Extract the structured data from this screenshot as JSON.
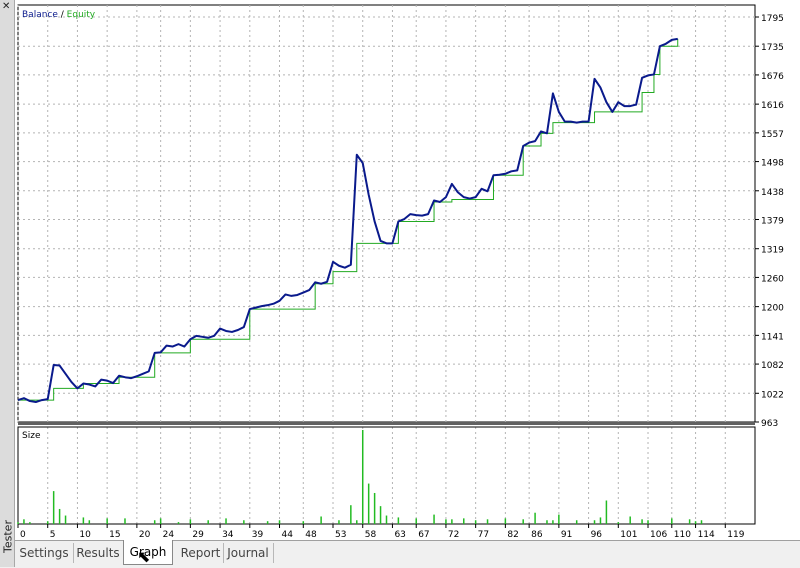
{
  "window": {
    "side_label": "Tester",
    "close_glyph": "✕"
  },
  "tabs": [
    "Settings",
    "Results",
    "Graph",
    "Report",
    "Journal"
  ],
  "active_tab": "Graph",
  "colors": {
    "balance": "#0a1a8c",
    "equity": "#22aa22",
    "size_bars": "#22bb22",
    "grid": "#b4b4b4",
    "frame": "#000000"
  },
  "chart_data": [
    {
      "type": "line",
      "legend": [
        {
          "name": "Balance",
          "color": "#0a1a8c"
        },
        {
          "name": "Equity",
          "color": "#22aa22"
        }
      ],
      "ylim": [
        963,
        1795
      ],
      "y_ticks": [
        1795,
        1735,
        1676,
        1616,
        1557,
        1498,
        1438,
        1379,
        1319,
        1260,
        1200,
        1141,
        1082,
        1022,
        963
      ],
      "x_ticks": [
        0,
        5,
        10,
        15,
        20,
        24,
        29,
        34,
        39,
        44,
        48,
        53,
        58,
        63,
        67,
        72,
        77,
        82,
        86,
        91,
        96,
        101,
        106,
        110,
        114,
        119
      ],
      "xlim": [
        0,
        124
      ],
      "series": [
        {
          "name": "Balance",
          "points": [
            [
              0,
              1008
            ],
            [
              1,
              1012
            ],
            [
              2,
              1006
            ],
            [
              3,
              1004
            ],
            [
              4,
              1008
            ],
            [
              5,
              1010
            ],
            [
              6,
              1080
            ],
            [
              7,
              1079
            ],
            [
              8,
              1062
            ],
            [
              9,
              1045
            ],
            [
              10,
              1032
            ],
            [
              11,
              1042
            ],
            [
              12,
              1040
            ],
            [
              13,
              1036
            ],
            [
              14,
              1050
            ],
            [
              15,
              1048
            ],
            [
              16,
              1043
            ],
            [
              17,
              1058
            ],
            [
              18,
              1055
            ],
            [
              19,
              1053
            ],
            [
              20,
              1057
            ],
            [
              21,
              1062
            ],
            [
              22,
              1067
            ],
            [
              23,
              1105
            ],
            [
              24,
              1106
            ],
            [
              25,
              1120
            ],
            [
              26,
              1118
            ],
            [
              27,
              1123
            ],
            [
              28,
              1118
            ],
            [
              29,
              1133
            ],
            [
              30,
              1140
            ],
            [
              31,
              1138
            ],
            [
              32,
              1136
            ],
            [
              33,
              1140
            ],
            [
              34,
              1155
            ],
            [
              35,
              1150
            ],
            [
              36,
              1148
            ],
            [
              37,
              1152
            ],
            [
              38,
              1158
            ],
            [
              39,
              1195
            ],
            [
              40,
              1198
            ],
            [
              41,
              1201
            ],
            [
              42,
              1203
            ],
            [
              43,
              1206
            ],
            [
              44,
              1212
            ],
            [
              45,
              1225
            ],
            [
              46,
              1222
            ],
            [
              47,
              1224
            ],
            [
              48,
              1229
            ],
            [
              49,
              1234
            ],
            [
              50,
              1250
            ],
            [
              51,
              1247
            ],
            [
              52,
              1251
            ],
            [
              53,
              1292
            ],
            [
              54,
              1284
            ],
            [
              55,
              1280
            ],
            [
              56,
              1286
            ],
            [
              57,
              1512
            ],
            [
              58,
              1495
            ],
            [
              59,
              1430
            ],
            [
              60,
              1375
            ],
            [
              61,
              1335
            ],
            [
              62,
              1330
            ],
            [
              63,
              1330
            ],
            [
              64,
              1375
            ],
            [
              65,
              1380
            ],
            [
              66,
              1390
            ],
            [
              67,
              1388
            ],
            [
              68,
              1387
            ],
            [
              69,
              1390
            ],
            [
              70,
              1418
            ],
            [
              71,
              1415
            ],
            [
              72,
              1425
            ],
            [
              73,
              1452
            ],
            [
              74,
              1435
            ],
            [
              75,
              1425
            ],
            [
              76,
              1422
            ],
            [
              77,
              1425
            ],
            [
              78,
              1442
            ],
            [
              79,
              1437
            ],
            [
              80,
              1470
            ],
            [
              81,
              1471
            ],
            [
              82,
              1473
            ],
            [
              83,
              1478
            ],
            [
              84,
              1480
            ],
            [
              85,
              1530
            ],
            [
              86,
              1537
            ],
            [
              87,
              1540
            ],
            [
              88,
              1560
            ],
            [
              89,
              1556
            ],
            [
              90,
              1638
            ],
            [
              91,
              1600
            ],
            [
              92,
              1580
            ],
            [
              93,
              1580
            ],
            [
              94,
              1578
            ],
            [
              95,
              1580
            ],
            [
              96,
              1580
            ],
            [
              97,
              1668
            ],
            [
              98,
              1650
            ],
            [
              99,
              1620
            ],
            [
              100,
              1600
            ],
            [
              101,
              1620
            ],
            [
              102,
              1612
            ],
            [
              103,
              1612
            ],
            [
              104,
              1615
            ],
            [
              105,
              1670
            ],
            [
              106,
              1675
            ],
            [
              107,
              1677
            ],
            [
              108,
              1735
            ],
            [
              109,
              1740
            ],
            [
              110,
              1748
            ],
            [
              111,
              1750
            ]
          ]
        },
        {
          "name": "Equity",
          "points": [
            [
              0,
              1008
            ],
            [
              5,
              1008
            ],
            [
              6,
              1032
            ],
            [
              10,
              1032
            ],
            [
              11,
              1042
            ],
            [
              17,
              1055
            ],
            [
              23,
              1105
            ],
            [
              29,
              1133
            ],
            [
              39,
              1195
            ],
            [
              50,
              1247
            ],
            [
              53,
              1272
            ],
            [
              56,
              1272
            ],
            [
              57,
              1330
            ],
            [
              63,
              1330
            ],
            [
              64,
              1375
            ],
            [
              70,
              1415
            ],
            [
              73,
              1420
            ],
            [
              80,
              1470
            ],
            [
              85,
              1530
            ],
            [
              88,
              1556
            ],
            [
              90,
              1578
            ],
            [
              96,
              1578
            ],
            [
              97,
              1600
            ],
            [
              104,
              1600
            ],
            [
              105,
              1640
            ],
            [
              107,
              1677
            ],
            [
              108,
              1735
            ],
            [
              111,
              1750
            ]
          ]
        }
      ]
    },
    {
      "type": "bar",
      "label": "Size",
      "x": [
        0,
        1,
        2,
        5,
        6,
        7,
        8,
        11,
        12,
        15,
        18,
        23,
        24,
        27,
        29,
        32,
        35,
        38,
        42,
        44,
        48,
        51,
        54,
        56,
        57,
        58,
        59,
        60,
        61,
        62,
        64,
        67,
        70,
        72,
        73,
        75,
        77,
        79,
        82,
        85,
        87,
        89,
        90,
        91,
        94,
        97,
        98,
        99,
        101,
        103,
        105,
        106,
        110,
        113,
        114,
        115
      ],
      "values": [
        0.02,
        0.05,
        0.02,
        0.03,
        0.35,
        0.16,
        0.09,
        0.07,
        0.04,
        0.06,
        0.06,
        0.04,
        0.06,
        0.02,
        0.05,
        0.04,
        0.06,
        0.04,
        0.03,
        0.04,
        0.03,
        0.08,
        0.04,
        0.2,
        0.04,
        1.0,
        0.43,
        0.33,
        0.19,
        0.09,
        0.07,
        0.06,
        0.1,
        0.05,
        0.05,
        0.06,
        0.04,
        0.05,
        0.06,
        0.05,
        0.12,
        0.04,
        0.04,
        0.1,
        0.04,
        0.04,
        0.07,
        0.25,
        0.02,
        0.08,
        0.05,
        0.04,
        0.06,
        0.05,
        0.03,
        0.04
      ]
    }
  ]
}
